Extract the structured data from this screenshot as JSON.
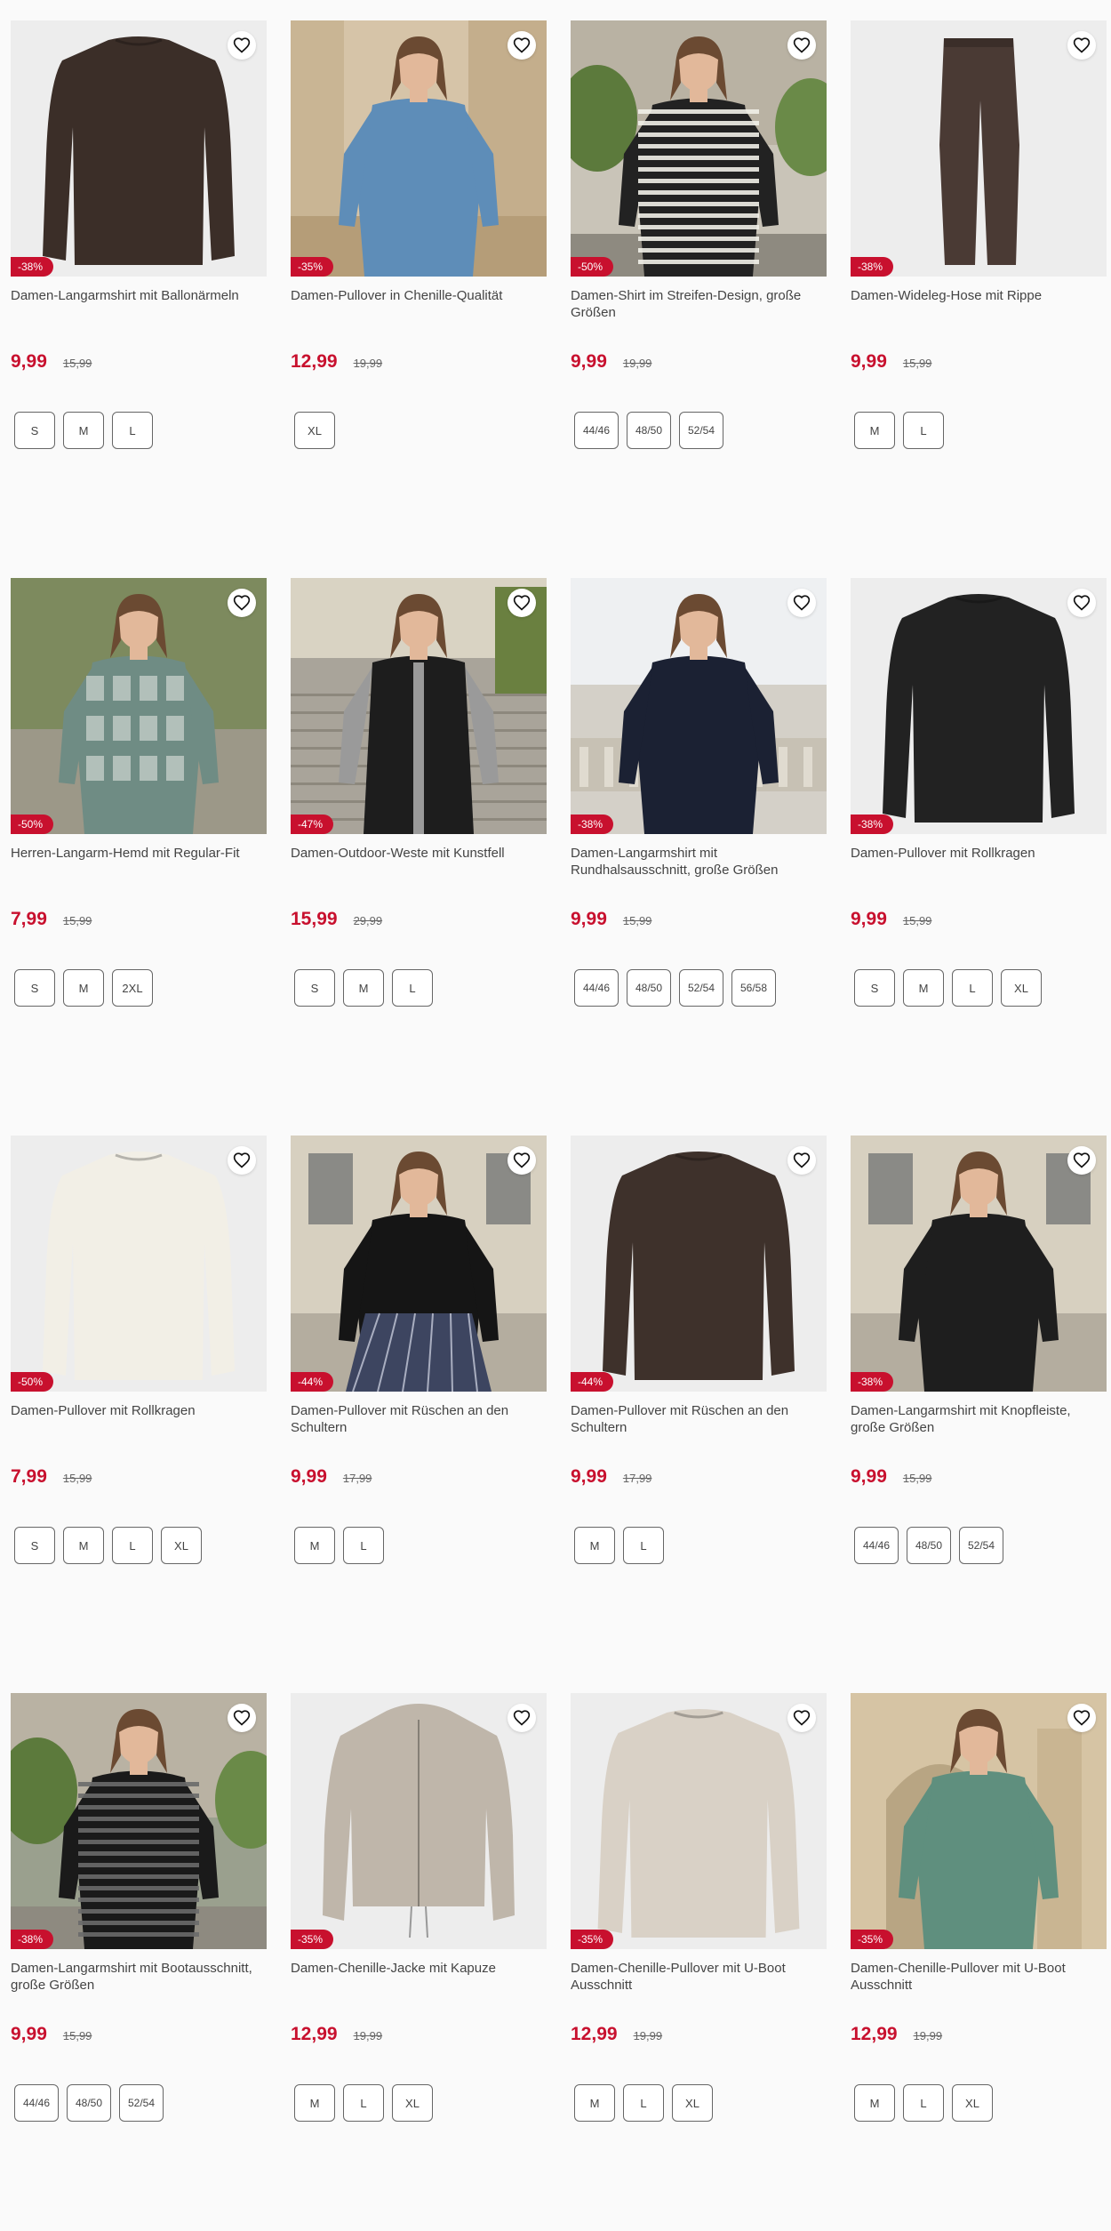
{
  "products": [
    {
      "title": "Damen-Langarmshirt mit Ballonärmeln",
      "badge": "-38%",
      "price": "9,99",
      "old_price": "15,99",
      "sizes": [
        "S",
        "M",
        "L"
      ],
      "bg": "#ededed",
      "garment": "#3b2e28",
      "type": "top",
      "scene": "studio"
    },
    {
      "title": "Damen-Pullover in Chenille-Qualität",
      "badge": "-35%",
      "price": "12,99",
      "old_price": "19,99",
      "sizes": [
        "XL"
      ],
      "bg": "#d6c4a8",
      "garment": "#5e8db8",
      "type": "model",
      "scene": "wall"
    },
    {
      "title": "Damen-Shirt im Streifen-Design, große Größen",
      "badge": "-50%",
      "price": "9,99",
      "old_price": "19,99",
      "sizes": [
        "44/46",
        "48/50",
        "52/54"
      ],
      "bg": "#c9c4b8",
      "garment": "#222222",
      "type": "model-stripes",
      "scene": "garden"
    },
    {
      "title": "Damen-Wideleg-Hose mit Rippe",
      "badge": "-38%",
      "price": "9,99",
      "old_price": "15,99",
      "sizes": [
        "M",
        "L"
      ],
      "bg": "#ededed",
      "garment": "#4a3a34",
      "type": "pants",
      "scene": "studio"
    },
    {
      "title": "Herren-Langarm-Hemd mit Regular-Fit",
      "badge": "-50%",
      "price": "7,99",
      "old_price": "15,99",
      "sizes": [
        "S",
        "M",
        "2XL"
      ],
      "bg": "#8a8f84",
      "garment": "#6f8c84",
      "type": "model-pattern",
      "scene": "park"
    },
    {
      "title": "Damen-Outdoor-Weste mit Kunstfell",
      "badge": "-47%",
      "price": "15,99",
      "old_price": "29,99",
      "sizes": [
        "S",
        "M",
        "L"
      ],
      "bg": "#a9a49a",
      "garment": "#1d1d1d",
      "type": "model-vest",
      "scene": "stairs"
    },
    {
      "title": "Damen-Langarmshirt mit Rundhalsausschnitt, große Größen",
      "badge": "-38%",
      "price": "9,99",
      "old_price": "15,99",
      "sizes": [
        "44/46",
        "48/50",
        "52/54",
        "56/58"
      ],
      "bg": "#d4d0c8",
      "garment": "#1b2133",
      "type": "model",
      "scene": "terrace"
    },
    {
      "title": "Damen-Pullover mit Rollkragen",
      "badge": "-38%",
      "price": "9,99",
      "old_price": "15,99",
      "sizes": [
        "S",
        "M",
        "L",
        "XL"
      ],
      "bg": "#ededed",
      "garment": "#222222",
      "type": "top",
      "scene": "studio"
    },
    {
      "title": "Damen-Pullover mit Rollkragen",
      "badge": "-50%",
      "price": "7,99",
      "old_price": "15,99",
      "sizes": [
        "S",
        "M",
        "L",
        "XL"
      ],
      "bg": "#ededed",
      "garment": "#f2efe6",
      "type": "top",
      "scene": "studio"
    },
    {
      "title": "Damen-Pullover mit Rüschen an den Schultern",
      "badge": "-44%",
      "price": "9,99",
      "old_price": "17,99",
      "sizes": [
        "M",
        "L"
      ],
      "bg": "#c7c0b3",
      "garment": "#151515",
      "type": "model-skirt",
      "scene": "building"
    },
    {
      "title": "Damen-Pullover mit Rüschen an den Schultern",
      "badge": "-44%",
      "price": "9,99",
      "old_price": "17,99",
      "sizes": [
        "M",
        "L"
      ],
      "bg": "#ededed",
      "garment": "#3e312b",
      "type": "top",
      "scene": "studio"
    },
    {
      "title": "Damen-Langarmshirt mit Knopfleiste, große Größen",
      "badge": "-38%",
      "price": "9,99",
      "old_price": "15,99",
      "sizes": [
        "44/46",
        "48/50",
        "52/54"
      ],
      "bg": "#cfc8ba",
      "garment": "#1e1e1e",
      "type": "model",
      "scene": "building"
    },
    {
      "title": "Damen-Langarmshirt mit Bootausschnitt, große Größen",
      "badge": "-38%",
      "price": "9,99",
      "old_price": "15,99",
      "sizes": [
        "44/46",
        "48/50",
        "52/54"
      ],
      "bg": "#9aa08e",
      "garment": "#1a1a1a",
      "type": "model-stripes-dark",
      "scene": "garden"
    },
    {
      "title": "Damen-Chenille-Jacke mit Kapuze",
      "badge": "-35%",
      "price": "12,99",
      "old_price": "19,99",
      "sizes": [
        "M",
        "L",
        "XL"
      ],
      "bg": "#ededed",
      "garment": "#bfb6aa",
      "type": "hoodie",
      "scene": "studio"
    },
    {
      "title": "Damen-Chenille-Pullover mit U-Boot Ausschnitt",
      "badge": "-35%",
      "price": "12,99",
      "old_price": "19,99",
      "sizes": [
        "M",
        "L",
        "XL"
      ],
      "bg": "#ededed",
      "garment": "#d9d1c6",
      "type": "top-wide",
      "scene": "studio"
    },
    {
      "title": "Damen-Chenille-Pullover mit U-Boot Ausschnitt",
      "badge": "-35%",
      "price": "12,99",
      "old_price": "19,99",
      "sizes": [
        "M",
        "L",
        "XL"
      ],
      "bg": "#cdbb9e",
      "garment": "#5f8f7e",
      "type": "model",
      "scene": "arch"
    }
  ],
  "colors": {
    "accent": "#c8102e"
  }
}
